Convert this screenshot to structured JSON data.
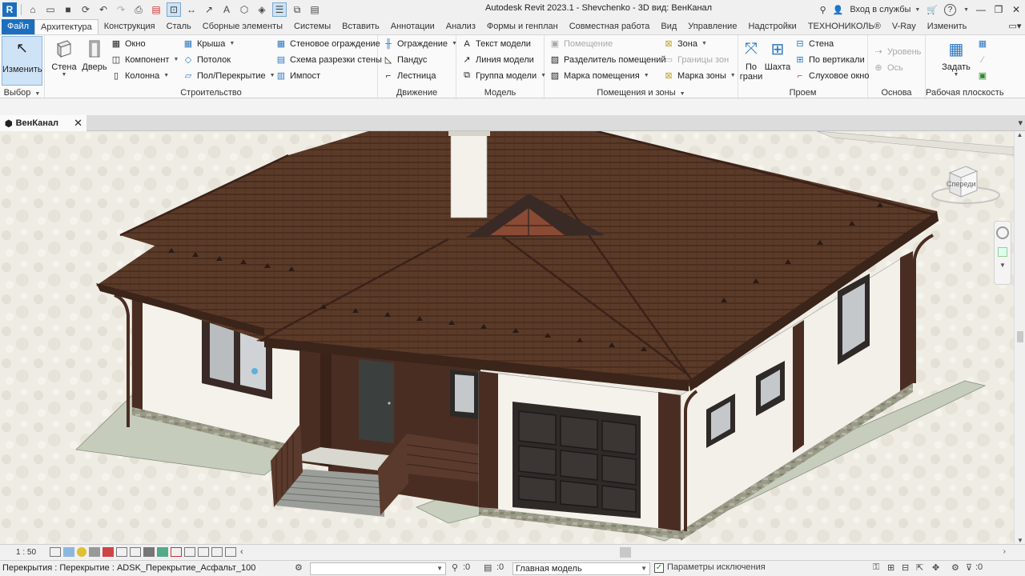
{
  "app": {
    "title": "Autodesk Revit 2023.1 - Shevchenko - 3D вид: ВенКанал",
    "logo": "R",
    "login_label": "Вход в службы",
    "help_label": "?"
  },
  "tabs": [
    "Файл",
    "Архитектура",
    "Конструкция",
    "Сталь",
    "Сборные элементы",
    "Системы",
    "Вставить",
    "Аннотации",
    "Анализ",
    "Формы и генплан",
    "Совместная работа",
    "Вид",
    "Управление",
    "Надстройки",
    "ТЕХНОНИКОЛЬ®",
    "V-Ray",
    "Изменить"
  ],
  "active_tab": "Архитектура",
  "ribbon": {
    "select": {
      "modify": "Изменить",
      "panel": "Выбор"
    },
    "build": {
      "wall": "Стена",
      "door": "Дверь",
      "window": "Окно",
      "component": "Компонент",
      "column": "Колонна",
      "roof": "Крыша",
      "ceiling": "Потолок",
      "floor": "Пол/Перекрытие",
      "curtain_system": "Стеновое ограждение",
      "curtain_grid": "Схема разрезки стены",
      "mullion": "Импост",
      "panel": "Строительство"
    },
    "circulation": {
      "railing": "Ограждение",
      "ramp": "Пандус",
      "stair": "Лестница",
      "panel": "Движение"
    },
    "model": {
      "model_text": "Текст модели",
      "model_line": "Линия модели",
      "model_group": "Группа модели",
      "panel": "Модель"
    },
    "room": {
      "room": "Помещение",
      "room_separator": "Разделитель помещений",
      "room_tag": "Марка помещения",
      "area": "Зона",
      "area_boundary": "Границы зон",
      "area_tag": "Марка зоны",
      "panel": "Помещения и зоны"
    },
    "opening": {
      "by_face": "По грани",
      "by_face_line2": "грани",
      "by_face_line1": "По",
      "shaft": "Шахта",
      "wall": "Стена",
      "vertical": "По вертикали",
      "dormer": "Слуховое окно",
      "panel": "Проем"
    },
    "datum": {
      "level": "Уровень",
      "grid": "Ось",
      "panel": "Основа"
    },
    "workplane": {
      "set": "Задать",
      "panel": "Рабочая плоскость"
    }
  },
  "view_tab": {
    "name": "ВенКанал",
    "close": "✕"
  },
  "viewcube": {
    "face": "Спереди"
  },
  "view_bar": {
    "scale": "1 : 50"
  },
  "status": {
    "text": "Перекрытия : Перекрытие : ADSK_Перекрытие_Асфальт_100",
    "coord": ":0",
    "coord2": ":0",
    "model": "Главная модель",
    "exclusions": "Параметры исключения",
    "filter_count": ":0"
  },
  "colors": {
    "file_tab": "#1c6fbf",
    "roof": "#5b3a28",
    "wall": "#f4f2ea",
    "trim": "#4a2d22",
    "ground": "#efece4"
  }
}
